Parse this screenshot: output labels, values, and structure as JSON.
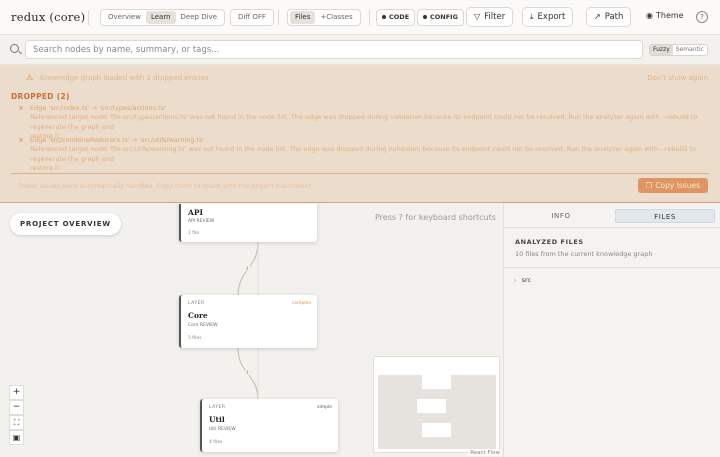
{
  "app": {
    "title": "redux (core)"
  },
  "toolbar": {
    "view_modes": [
      "Overview",
      "Learn",
      "Deep Dive"
    ],
    "active_view": "Learn",
    "diff_label": "Diff OFF",
    "granularity": [
      "Files",
      "+Classes"
    ],
    "active_granularity": "Files",
    "code_label": "CODE",
    "config_label": "CONFIG",
    "filter_label": "Filter",
    "export_label": "Export",
    "path_label": "Path",
    "theme_label": "Theme",
    "help_label": "?"
  },
  "search": {
    "placeholder": "Search nodes by name, summary, or tags...",
    "value": "",
    "modes": [
      "Fuzzy",
      "Semantic"
    ],
    "active_mode": "Fuzzy"
  },
  "issues": {
    "heading": "Knowledge graph loaded with 2 dropped entries",
    "dismiss_label": "Don't show again",
    "dropped_label": "DROPPED (2)",
    "items": [
      {
        "title": "Edge 'src/index.ts' → 'src/types/actions.ts'",
        "detail": "Referenced target node 'file:src/types/actions.ts' was not found in the node list. The edge was dropped during validation because its endpoint could not be resolved. Run the analyzer again with --rebuild to regenerate the graph and",
        "extra": "restore it."
      },
      {
        "title": "Edge 'src/combineReducers.ts' → 'src/utils/warning.ts'",
        "detail": "Referenced target node 'file:src/utils/warning.ts' was not found in the node list. The edge was dropped during validation because its endpoint could not be resolved. Run the analyzer again with --rebuild to regenerate the graph and",
        "extra": "restore it."
      }
    ],
    "footer": "These issues were automatically handled. Copy them to share with the project maintainer.",
    "copy_label": "Copy Issues"
  },
  "canvas": {
    "overview_label": "PROJECT OVERVIEW",
    "hint": "Press ? for keyboard shortcuts",
    "nodes": [
      {
        "layer": "",
        "complexity": "",
        "name": "API",
        "subtitle": "API REVIEW",
        "files": "1 file"
      },
      {
        "layer": "LAYER",
        "complexity": "complex",
        "name": "Core",
        "subtitle": "Core REVIEW",
        "files": "5 files"
      },
      {
        "layer": "LAYER",
        "complexity": "simple",
        "name": "Util",
        "subtitle": "Util REVIEW",
        "files": "4 files"
      }
    ],
    "edge_labels": [
      "4",
      "4"
    ],
    "controls": {
      "zoom_in": "+",
      "zoom_out": "−",
      "fit": "⛶",
      "lock": "▣"
    },
    "attribution": "React Flow"
  },
  "panel": {
    "tabs": [
      "INFO",
      "FILES"
    ],
    "active_tab": "FILES",
    "title": "ANALYZED FILES",
    "subtitle": "10 files from the current knowledge graph",
    "tree": [
      {
        "label": "src",
        "chevron": "›"
      }
    ]
  },
  "colors": {
    "banner_bg": "#ecdccb",
    "accent_orange": "#de9561",
    "complex": "#e08a4a",
    "simple": "#5a8a5a"
  },
  "icons": {
    "filter": "funnel-icon",
    "export": "download-icon",
    "path": "trend-arrow-icon",
    "theme": "palette-icon",
    "search": "search-icon",
    "warning": "warning-icon"
  }
}
